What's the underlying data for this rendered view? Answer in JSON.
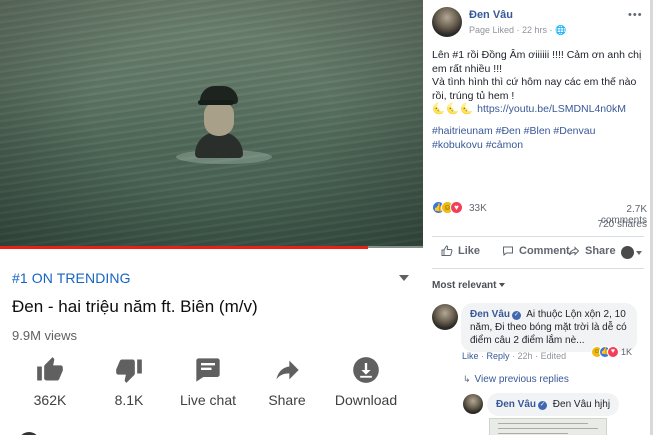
{
  "youtube": {
    "trending_label": "#1 ON TRENDING",
    "video_title": "Đen - hai triệu năm ft. Biên (m/v)",
    "views": "9.9M views",
    "progress_fraction": 0.87,
    "progress_color": "#e62117",
    "actions": [
      {
        "icon": "thumbs-up-icon",
        "label": "362K"
      },
      {
        "icon": "thumbs-down-icon",
        "label": "8.1K"
      },
      {
        "icon": "live-chat-icon",
        "label": "Live chat"
      },
      {
        "icon": "share-icon",
        "label": "Share"
      },
      {
        "icon": "download-icon",
        "label": "Download"
      }
    ]
  },
  "facebook": {
    "post": {
      "author": "Đen Vâu",
      "meta": "Page Liked · 22 hrs ·",
      "text_line1": "Lên #1 rồi Đồng Âm ơiiiiii !!!! Cảm ơn anh chị em rất nhiều !!!",
      "text_line2": "Và tình hình thì cứ hôm nay các em thế nào rồi, trúng tủ hem !",
      "moons": "🌜🌜🌜",
      "link": "https://youtu.be/LSMDNL4n0kM",
      "hashtags": "#haitrieunam #Đen #Blen #Denvau #kobukovu #cảmon"
    },
    "reactions": {
      "count": "33K",
      "comments": "2.7K comments",
      "shares": "720 shares"
    },
    "actions": {
      "like": "Like",
      "comment": "Comment",
      "share": "Share"
    },
    "sort_label": "Most relevant",
    "comment1": {
      "author": "Đen Vâu",
      "text": "Ai thuộc Lộn xộn 2, 10 năm, Đi theo bóng mặt trời là dễ có điểm câu 2 điểm lắm nè...",
      "like": "Like",
      "reply": "Reply",
      "time": "22h",
      "edited": "Edited",
      "react_count": "1K"
    },
    "view_previous": "View previous replies",
    "comment2": {
      "author": "Đen Vâu",
      "text": "Đen Vâu hjhj"
    },
    "brand_color": "#385898"
  }
}
